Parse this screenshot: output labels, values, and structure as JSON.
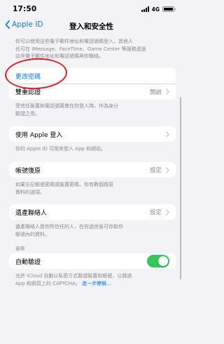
{
  "status_bar": {
    "time": "17:50",
    "network": "4G"
  },
  "nav": {
    "back_label": "Apple ID",
    "title": "登入和安全性"
  },
  "intro_footer": {
    "line1": "你可以使用這些電子郵件地址和電話號碼登入，其他人",
    "line2": "也可在 iMessage、FaceTime、Game Center 等服務透過",
    "line3": "這些電子郵件地址和電話號碼與你聯絡。"
  },
  "password": {
    "change_label": "更改密碼"
  },
  "two_factor": {
    "label": "雙重認證",
    "value": "開啟",
    "footer_line1": "受信任裝置和電話號碼會在你登入時，作為身分",
    "footer_line2": "驗證之用。"
  },
  "sign_in_with_apple": {
    "label": "使用 Apple 登入",
    "footer": "你的 Apple ID 可用來登入 App 和網站。"
  },
  "account_recovery": {
    "label": "帳號復原",
    "value": "設定",
    "footer_line1": "如果忘記帳號密碼或裝置密碼，你有數個復原",
    "footer_line2": "資料的選項。"
  },
  "legacy_contact": {
    "label": "遺產聯絡人",
    "value": "設定",
    "footer_line1": "遺產聯絡人是你所信任的人，在你過世後可存取你",
    "footer_line2": "帳號內的資料。"
  },
  "advanced": {
    "header": "進階",
    "auto_verify_label": "自動驗證",
    "toggle_on": true,
    "footer_line1": "允許 iCloud 自動以私密方式驗證裝置和帳號，以跳過",
    "footer_line2_prefix": "App 和網頁上的 CAPTCHA。",
    "learn_more": "進一步瞭解…"
  },
  "colors": {
    "accent": "#0a7aff",
    "toggle_on": "#34c759",
    "annotation_circle": "#e31e1e"
  }
}
